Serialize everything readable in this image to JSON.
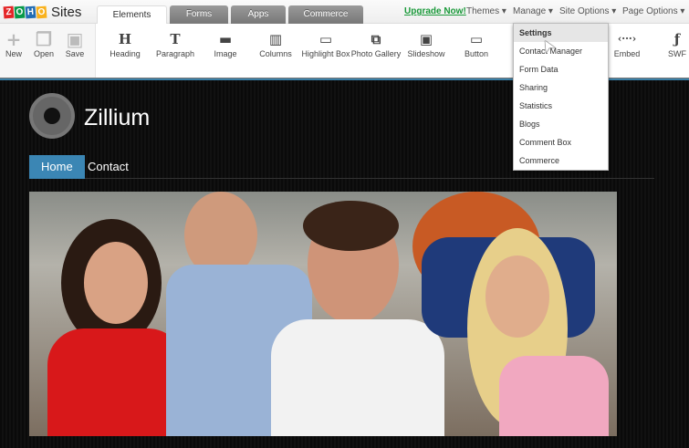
{
  "app": {
    "logo_letters": [
      "Z",
      "O",
      "H",
      "O"
    ],
    "logo_colors": [
      "#e42527",
      "#089949",
      "#226db4",
      "#f9b21d"
    ],
    "name": "Sites"
  },
  "tabs": [
    {
      "label": "Elements",
      "active": true
    },
    {
      "label": "Forms"
    },
    {
      "label": "Apps"
    },
    {
      "label": "Commerce"
    }
  ],
  "topnav": {
    "upgrade": "Upgrade Now!",
    "themes": "Themes ▾",
    "manage": "Manage ▾",
    "site_options": "Site Options ▾",
    "page_options": "Page Options ▾"
  },
  "file_tools": [
    {
      "label": "New",
      "icon": "+"
    },
    {
      "label": "Open",
      "icon": "❐"
    },
    {
      "label": "Save",
      "icon": "▣"
    }
  ],
  "elements": [
    {
      "label": "Heading",
      "icon": "H"
    },
    {
      "label": "Paragraph",
      "icon": "T"
    },
    {
      "label": "Image",
      "icon": "▬"
    },
    {
      "label": "Columns",
      "icon": "▥"
    },
    {
      "label": "Highlight Box",
      "icon": "▭"
    },
    {
      "label": "Photo Gallery",
      "icon": "⧉"
    },
    {
      "label": "Slideshow",
      "icon": "▣"
    },
    {
      "label": "Button",
      "icon": "▭"
    },
    {
      "label": "Embed",
      "icon": "‹···›"
    },
    {
      "label": "SWF",
      "icon": "ƒ"
    }
  ],
  "manage_menu": [
    "Settings",
    "Contact Manager",
    "Form Data",
    "Sharing",
    "Statistics",
    "Blogs",
    "Comment Box",
    "Commerce"
  ],
  "site": {
    "title": "Zillium",
    "nav": [
      "Home",
      "Contact"
    ]
  }
}
